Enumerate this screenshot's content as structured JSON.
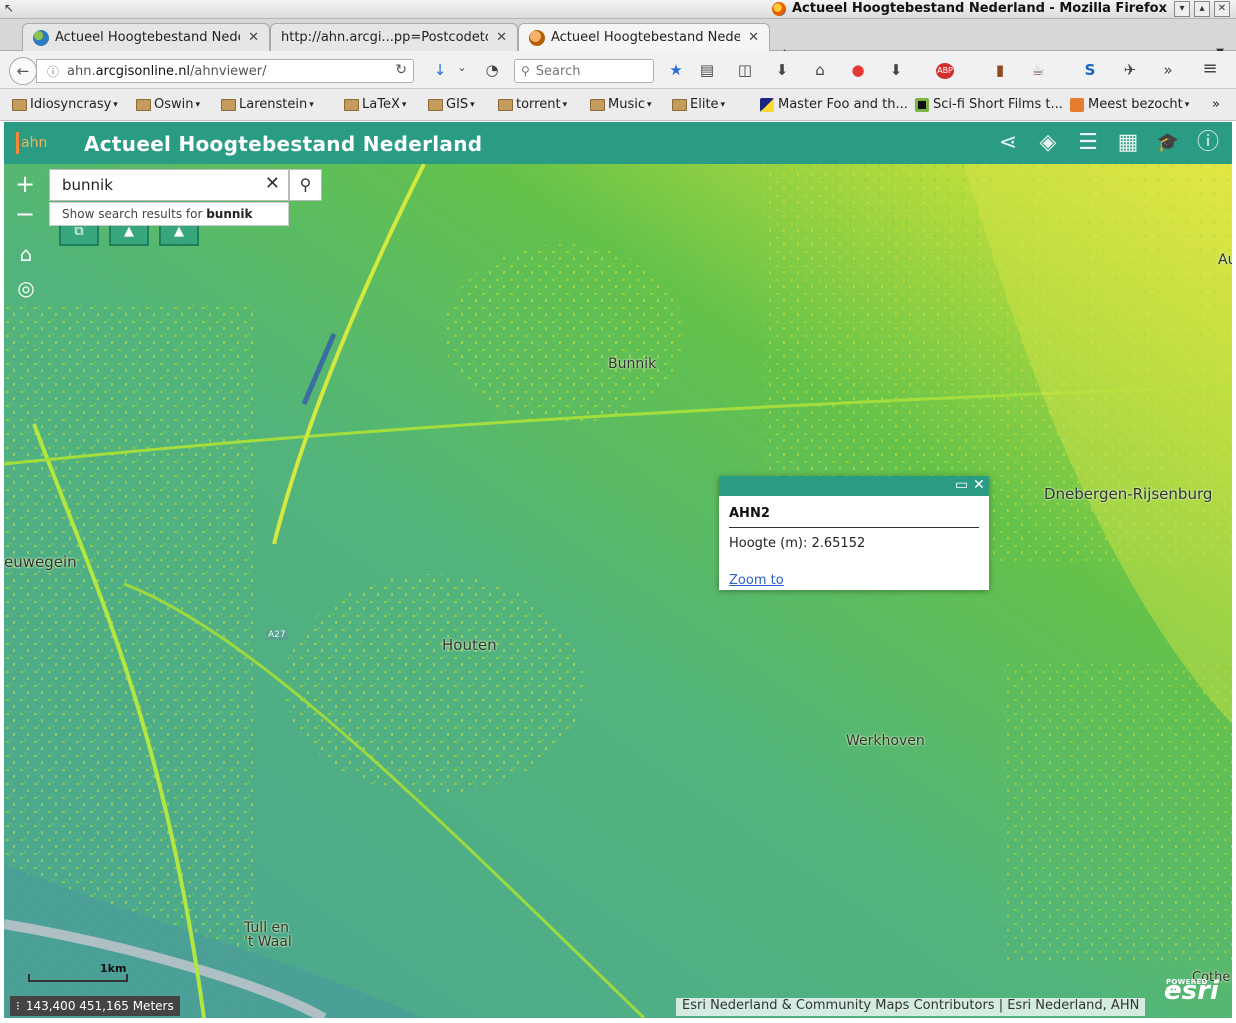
{
  "window": {
    "title": "Actueel Hoogtebestand Nederland - Mozilla Firefox",
    "corner_glyph": "↖",
    "buttons": [
      "▾",
      "▴",
      "✕"
    ]
  },
  "tabs": [
    {
      "label": "Actueel Hoogtebestand Nede...",
      "favicon": "globe-icon"
    },
    {
      "label": "http://ahn.arcgi...pp=Postcodetool",
      "favicon": "none"
    },
    {
      "label": "Actueel Hoogtebestand Nede...",
      "favicon": "ahn-icon",
      "active": true
    }
  ],
  "tab_close_glyph": "✕",
  "new_tab_glyph": "+",
  "tab_menu_glyph": "▼",
  "navbar": {
    "back_glyph": "←",
    "info_glyph": "ⓘ",
    "url_host": "ahn.",
    "url_domain": "arcgisonline.nl",
    "url_path": "/ahnviewer/",
    "reload_glyph": "↻",
    "search_placeholder": "Search",
    "search_glyph": "⚲",
    "icons": [
      "↓",
      "⌄",
      "◔",
      "★",
      "▤",
      "◫",
      "⬇",
      "⌂",
      "●",
      "⬇",
      "ABP",
      "▮",
      "☕",
      "S",
      "✈",
      "»",
      "≡"
    ]
  },
  "bookmarks": [
    {
      "label": "Idiosyncrasy",
      "type": "folder"
    },
    {
      "label": "Oswin",
      "type": "folder"
    },
    {
      "label": "Larenstein",
      "type": "folder"
    },
    {
      "label": "LaTeX",
      "type": "folder"
    },
    {
      "label": "GIS",
      "type": "folder"
    },
    {
      "label": "torrent",
      "type": "folder"
    },
    {
      "label": "Music",
      "type": "folder"
    },
    {
      "label": "Elite",
      "type": "folder"
    },
    {
      "label": "Master Foo and th...",
      "type": "link"
    },
    {
      "label": "Sci-fi Short Films t...",
      "type": "link"
    },
    {
      "label": "Meest bezocht",
      "type": "folder"
    }
  ],
  "bookmark_caret": "▾",
  "bookmark_overflow": "»",
  "app": {
    "logo_text": "ahn",
    "title": "Actueel Hoogtebestand Nederland",
    "header_icons": [
      "share-icon",
      "layers-icon",
      "legend-icon",
      "basemap-icon",
      "about-icon",
      "info-icon"
    ],
    "header_glyphs": [
      "⋖",
      "◈",
      "☰",
      "▦",
      "🎓",
      "ⓘ"
    ]
  },
  "map": {
    "zoom_in": "+",
    "zoom_out": "−",
    "home_glyph": "⌂",
    "locate_glyph": "◎",
    "search_value": "bunnik",
    "search_clear": "✕",
    "search_button_glyph": "⚲",
    "suggest_prefix": "Show search results for ",
    "suggest_term": "bunnik",
    "widget_glyphs": [
      "⧉",
      "▲",
      "▲"
    ],
    "places": [
      "Bunnik",
      "Dnebergen-Rijsenburg",
      "euwegein",
      "Houten",
      "Werkhoven",
      "Tull en",
      "'t Waal",
      "A27",
      "Au",
      "Cothe"
    ],
    "popup": {
      "title": "AHN2",
      "label": "Hoogte (m): ",
      "value": "2.65152",
      "link": "Zoom to",
      "maximize_glyph": "▭",
      "close_glyph": "✕"
    },
    "scale_label": "1km",
    "coords_glyph": "⁝",
    "coordinates": "143,400 451,165 Meters",
    "attribution": "Esri Nederland & Community Maps Contributors | Esri Nederland, AHN",
    "esri_powered": "POWERED BY",
    "esri_logo": "esri"
  },
  "colors": {
    "header": "#2b9c84",
    "terrain_low": "#4fa89a",
    "terrain_mid": "#58c04e",
    "terrain_high": "#e8e840",
    "link": "#2a61c2"
  }
}
